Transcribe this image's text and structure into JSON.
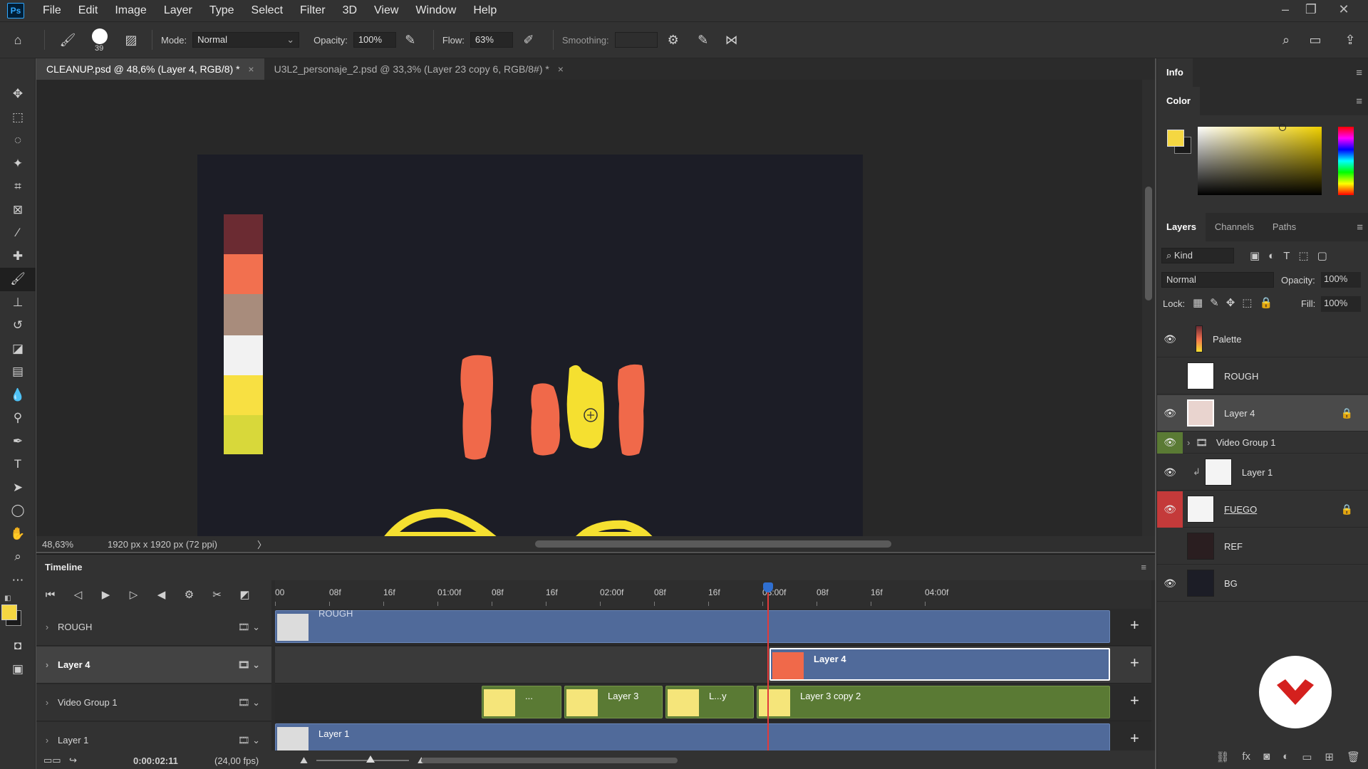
{
  "app": {
    "logo": "Ps"
  },
  "menu": [
    "File",
    "Edit",
    "Image",
    "Layer",
    "Type",
    "Select",
    "Filter",
    "3D",
    "View",
    "Window",
    "Help"
  ],
  "options": {
    "brush_size": "39",
    "mode_label": "Mode:",
    "mode_value": "Normal",
    "opacity_label": "Opacity:",
    "opacity_value": "100%",
    "flow_label": "Flow:",
    "flow_value": "63%",
    "smoothing_label": "Smoothing:"
  },
  "doc_tabs": [
    {
      "label": "CLEANUP.psd @ 48,6% (Layer 4, RGB/8) *",
      "close": "×"
    },
    {
      "label": "U3L2_personaje_2.psd @ 33,3% (Layer 23 copy 6, RGB/8#) *",
      "close": "×"
    }
  ],
  "canvas": {
    "palette_colors": [
      "#6b2b32",
      "#f2704f",
      "#a88c7c",
      "#f2f2f2",
      "#f8e042",
      "#d8d83a"
    ],
    "background": "#1c1d26",
    "stroke_orange": "#f0694a",
    "stroke_yellow": "#f5e030"
  },
  "status": {
    "zoom": "48,63%",
    "doc_info": "1920 px x 1920 px (72 ppi)",
    "arrow": "〉"
  },
  "timeline": {
    "title": "Timeline",
    "ruler_labels": [
      "00",
      "08f",
      "16f",
      "01:00f",
      "08f",
      "16f",
      "02:00f",
      "08f",
      "16f",
      "03:00f",
      "08f",
      "16f",
      "04:00f"
    ],
    "tracks": [
      {
        "name": "ROUGH",
        "clips": [
          {
            "name": "ROUGH"
          }
        ]
      },
      {
        "name": "Layer 4",
        "clips": [
          {
            "name": "Layer 4"
          }
        ]
      },
      {
        "name": "Video Group 1",
        "clips": [
          {
            "name": "..."
          },
          {
            "name": "Layer 3"
          },
          {
            "name": "L...y"
          },
          {
            "name": "Layer 3 copy 2"
          }
        ]
      },
      {
        "name": "Layer 1",
        "clips": [
          {
            "name": "Layer 1"
          }
        ]
      }
    ],
    "current_time": "0:00:02:11",
    "fps": "(24,00 fps)"
  },
  "panels": {
    "info_tab": "Info",
    "color_tab": "Color",
    "foreground_color": "#f5d742",
    "background_color": "#1a1a1a",
    "layer_tabs": [
      "Layers",
      "Channels",
      "Paths"
    ],
    "kind_label": "Kind",
    "blend_mode": "Normal",
    "opacity_label": "Opacity:",
    "opacity_value": "100%",
    "lock_label": "Lock:",
    "fill_label": "Fill:",
    "fill_value": "100%"
  },
  "layers": [
    {
      "name": "Palette",
      "visible": true
    },
    {
      "name": "ROUGH",
      "visible": false
    },
    {
      "name": "Layer 4",
      "visible": true,
      "selected": true,
      "locked": true
    },
    {
      "name": "Video Group 1",
      "visible": true,
      "group": true
    },
    {
      "name": "Layer 1",
      "visible": true
    },
    {
      "name": "FUEGO",
      "visible": true,
      "locked": true
    },
    {
      "name": "REF",
      "visible": false
    },
    {
      "name": "BG",
      "visible": true
    }
  ]
}
